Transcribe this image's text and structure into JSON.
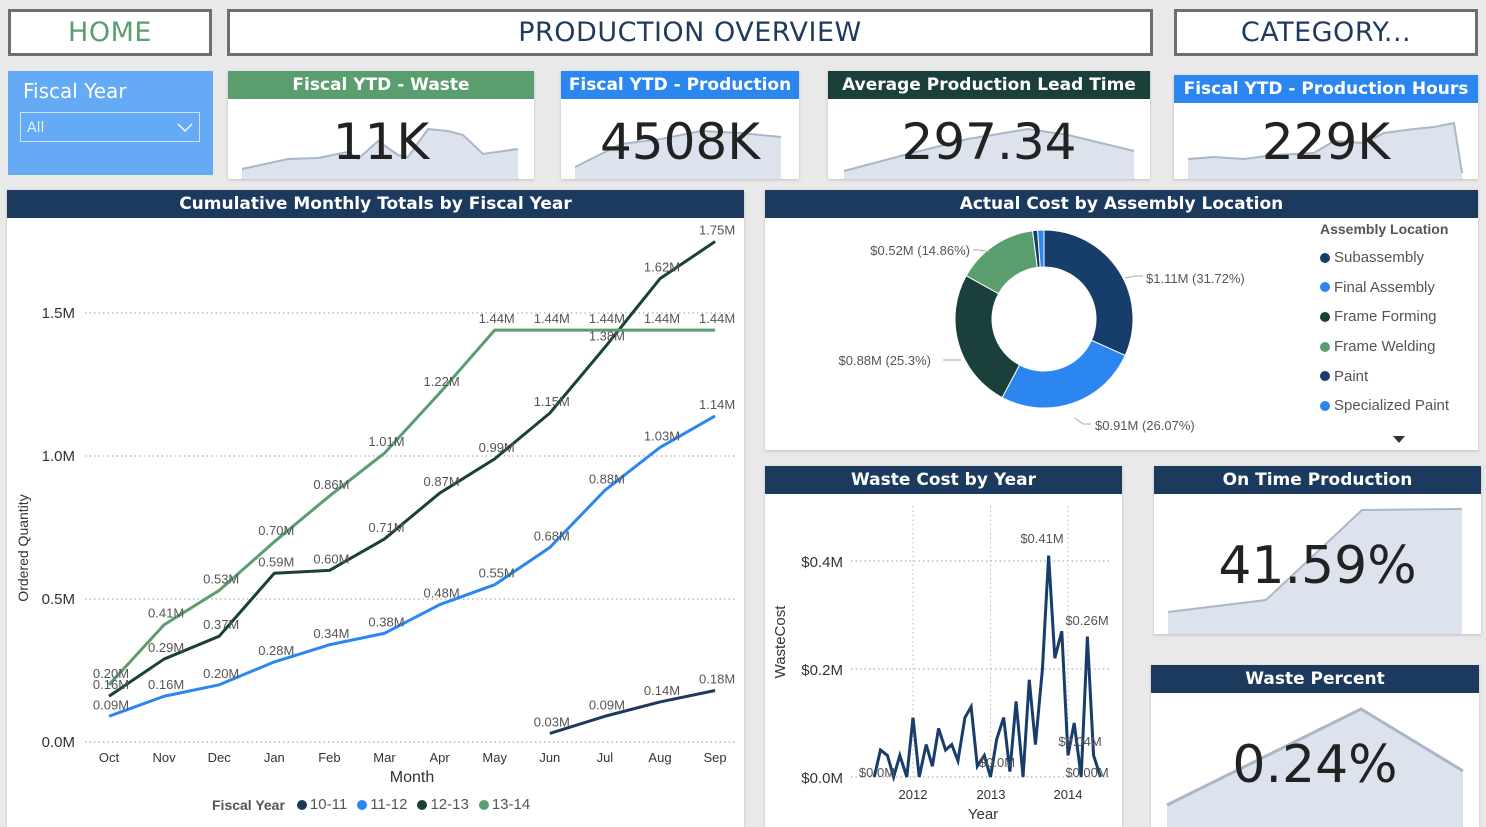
{
  "nav": {
    "home_label": "HOME",
    "title": "PRODUCTION OVERVIEW",
    "category_label": "CATEGORY..."
  },
  "colors": {
    "navy": "#1b3a5e",
    "green": "#5a9e6f",
    "lightblue": "#2b86f0",
    "darkgreen": "#1b3f3a",
    "slicer_bg": "#64aaf5"
  },
  "slicer": {
    "title": "Fiscal Year",
    "value": "All"
  },
  "kpis": [
    {
      "title": "Fiscal YTD - Waste",
      "value": "11K"
    },
    {
      "title": "Fiscal YTD - Production",
      "value": "4508K"
    },
    {
      "title": "Average Production Lead Time",
      "value": "297.34"
    },
    {
      "title": "Fiscal YTD - Production Hours",
      "value": "229K"
    }
  ],
  "cumulative": {
    "title": "Cumulative Monthly Totals by Fiscal Year",
    "xlabel": "Month",
    "ylabel": "Ordered Quantity",
    "legend_title": "Fiscal Year",
    "yticks": [
      "1.5M",
      "1.0M",
      "0.5M",
      "0.0M"
    ]
  },
  "donut": {
    "title": "Actual Cost by Assembly Location",
    "legend_title": "Assembly Location",
    "labels": {
      "subassembly": "$1.11M (31.72%)",
      "final": "$0.91M (26.07%)",
      "forming": "$0.88M (25.3%)",
      "welding": "$0.52M (14.86%)"
    },
    "legend": [
      "Subassembly",
      "Final Assembly",
      "Frame Forming",
      "Frame Welding",
      "Paint",
      "Specialized Paint"
    ]
  },
  "waste": {
    "title": "Waste Cost by Year",
    "xlabel": "Year",
    "ylabel": "WasteCost",
    "yticks": [
      "$0.4M",
      "$0.2M",
      "$0.0M"
    ],
    "xticks": [
      "2012",
      "2013",
      "2014"
    ],
    "labels": {
      "peak": "$0.41M",
      "second": "$0.26M",
      "mid": "$0.04M",
      "zero": "$0.0M",
      "zero2": "$0.00M"
    }
  },
  "ontime": {
    "title": "On Time Production",
    "value": "41.59%"
  },
  "wastepct": {
    "title": "Waste Percent",
    "value": "0.24%"
  },
  "chart_data": [
    {
      "type": "line",
      "title": "Cumulative Monthly Totals by Fiscal Year",
      "xlabel": "Month",
      "ylabel": "Ordered Quantity",
      "categories": [
        "Oct",
        "Nov",
        "Dec",
        "Jan",
        "Feb",
        "Mar",
        "Apr",
        "May",
        "Jun",
        "Jul",
        "Aug",
        "Sep"
      ],
      "ylim": [
        0,
        1.75
      ],
      "series": [
        {
          "name": "10-11",
          "color": "#1b3a5e",
          "values": [
            null,
            null,
            null,
            null,
            null,
            null,
            null,
            null,
            0.03,
            0.09,
            0.14,
            0.18
          ],
          "labels": [
            null,
            null,
            null,
            null,
            null,
            null,
            null,
            null,
            "0.03M",
            "0.09M",
            "0.14M",
            "0.18M"
          ]
        },
        {
          "name": "11-12",
          "color": "#2b86f0",
          "values": [
            0.09,
            0.16,
            0.2,
            0.28,
            0.34,
            0.38,
            0.48,
            0.55,
            0.68,
            0.88,
            1.03,
            1.14
          ],
          "labels": [
            "0.09M",
            "0.16M",
            "0.20M",
            "0.28M",
            "0.34M",
            "0.38M",
            "0.48M",
            "0.55M",
            "0.68M",
            "0.88M",
            "1.03M",
            "1.14M"
          ]
        },
        {
          "name": "12-13",
          "color": "#1b3f3a",
          "values": [
            0.16,
            0.29,
            0.37,
            0.59,
            0.6,
            0.71,
            0.87,
            0.99,
            1.15,
            1.38,
            1.62,
            1.75
          ],
          "labels": [
            "0.16M",
            "0.29M",
            "0.37M",
            "0.59M",
            "0.60M",
            "0.71M",
            "0.87M",
            "0.99M",
            "1.15M",
            "1.38M",
            "1.62M",
            "1.75M"
          ]
        },
        {
          "name": "13-14",
          "color": "#5a9e6f",
          "values": [
            0.2,
            0.41,
            0.53,
            0.7,
            0.86,
            1.01,
            1.22,
            1.44,
            1.44,
            1.44,
            1.44,
            1.44
          ],
          "labels": [
            "0.20M",
            "0.41M",
            "0.53M",
            "0.70M",
            "0.86M",
            "1.01M",
            "1.22M",
            "1.44M",
            "1.44M",
            "1.44M",
            "1.44M",
            "1.44M"
          ]
        }
      ]
    },
    {
      "type": "pie",
      "title": "Actual Cost by Assembly Location",
      "slices": [
        {
          "name": "Subassembly",
          "value": 1.11,
          "pct": 31.72,
          "color": "#173d6b"
        },
        {
          "name": "Final Assembly",
          "value": 0.91,
          "pct": 26.07,
          "color": "#2b86f0"
        },
        {
          "name": "Frame Forming",
          "value": 0.88,
          "pct": 25.3,
          "color": "#1b3f3a"
        },
        {
          "name": "Frame Welding",
          "value": 0.52,
          "pct": 14.86,
          "color": "#5a9e6f"
        },
        {
          "name": "Paint",
          "value": 0.03,
          "pct": 0.9,
          "color": "#173d6b"
        },
        {
          "name": "Specialized Paint",
          "value": 0.04,
          "pct": 1.15,
          "color": "#2b86f0"
        }
      ]
    },
    {
      "type": "line",
      "title": "Waste Cost by Year",
      "xlabel": "Year",
      "ylabel": "WasteCost",
      "ylim": [
        0,
        0.45
      ],
      "x": [
        2011.5,
        2011.58,
        2011.67,
        2011.75,
        2011.83,
        2011.92,
        2012.0,
        2012.08,
        2012.17,
        2012.25,
        2012.33,
        2012.42,
        2012.5,
        2012.58,
        2012.67,
        2012.75,
        2012.83,
        2012.92,
        2013.0,
        2013.08,
        2013.17,
        2013.25,
        2013.33,
        2013.42,
        2013.5,
        2013.58,
        2013.67,
        2013.75,
        2013.83,
        2013.92,
        2014.0,
        2014.08,
        2014.17,
        2014.25,
        2014.33,
        2014.42
      ],
      "values": [
        0.0,
        0.05,
        0.04,
        0.0,
        0.04,
        0.0,
        0.11,
        0.0,
        0.06,
        0.02,
        0.09,
        0.05,
        0.06,
        0.03,
        0.11,
        0.13,
        0.02,
        0.04,
        0.0,
        0.07,
        0.11,
        0.01,
        0.14,
        0.0,
        0.18,
        0.06,
        0.2,
        0.41,
        0.22,
        0.27,
        0.04,
        0.1,
        0.0,
        0.26,
        0.04,
        0.0
      ]
    }
  ]
}
